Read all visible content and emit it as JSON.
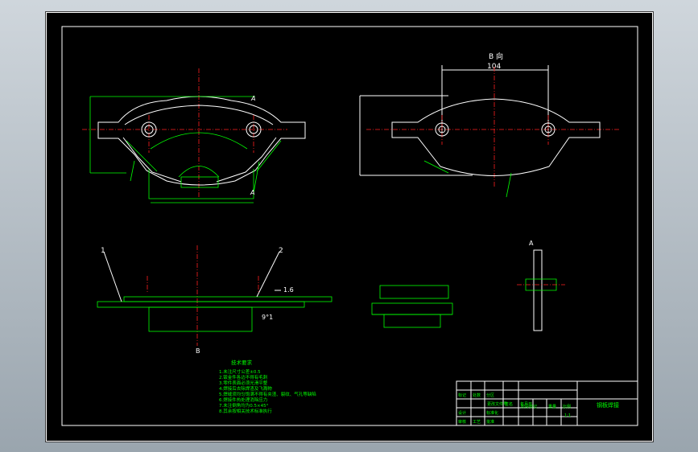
{
  "view_b_title": "B 向",
  "dim_top": "104",
  "labels": {
    "a": "A",
    "b": "B",
    "part1": "1",
    "part2": "2",
    "slope": "1.6",
    "angle": "9°1"
  },
  "tech_req": {
    "title": "技术要求",
    "lines": [
      "1.未注尺寸公差±0.5",
      "2.钣金件各边不得有毛刺",
      "3.零件表面必须光滑平整",
      "4.焊接后去除焊渣及飞溅物",
      "5.焊缝须均匀饱满不得有夹渣、裂纹、气孔等缺陷",
      "6.焊接件热处理消除应力",
      "7.未注倒角均为0.5×45°",
      "8.其余按相关技术标准执行"
    ]
  },
  "title_block": {
    "part_name": "钢板焊接",
    "row_a": [
      "标记",
      "处数",
      "分区",
      "更改文件号",
      "签名",
      "年月日"
    ],
    "row_b": [
      "设计",
      "标准化"
    ],
    "row_c": [
      "审核",
      "工艺",
      "批准"
    ],
    "mid": [
      "阶段标记",
      "重量",
      "比例"
    ],
    "scale": "1:1"
  }
}
